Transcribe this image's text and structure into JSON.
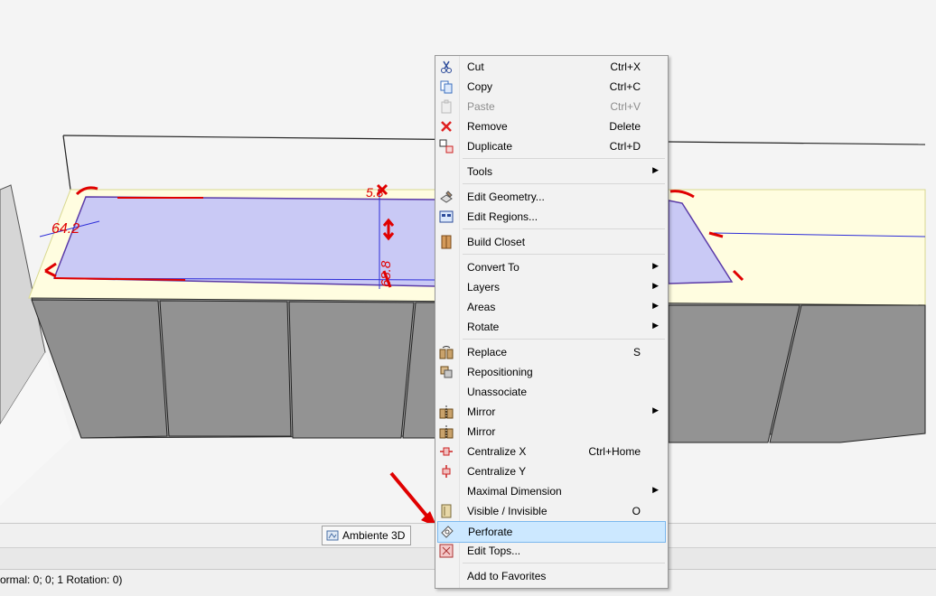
{
  "viewport": {
    "dimension_labels": [
      "64.2",
      "5.8",
      "68.8"
    ]
  },
  "tab": {
    "label": "Ambiente 3D"
  },
  "status": {
    "text": "ormal: 0; 0; 1 Rotation: 0)"
  },
  "menu": {
    "items": [
      {
        "label": "Cut",
        "shortcut": "Ctrl+X",
        "icon": "scissors-icon"
      },
      {
        "label": "Copy",
        "shortcut": "Ctrl+C",
        "icon": "copy-icon"
      },
      {
        "label": "Paste",
        "shortcut": "Ctrl+V",
        "icon": "paste-icon",
        "disabled": true
      },
      {
        "label": "Remove",
        "shortcut": "Delete",
        "icon": "remove-x-icon"
      },
      {
        "label": "Duplicate",
        "shortcut": "Ctrl+D",
        "icon": "duplicate-icon"
      },
      {
        "label": "Tools",
        "submenu": true
      },
      {
        "label": "Edit Geometry...",
        "icon": "edit-geometry-icon"
      },
      {
        "label": "Edit Regions...",
        "icon": "edit-regions-icon"
      },
      {
        "label": "Build Closet",
        "icon": "build-closet-icon"
      },
      {
        "label": "Convert To",
        "submenu": true
      },
      {
        "label": "Layers",
        "submenu": true
      },
      {
        "label": "Areas",
        "submenu": true
      },
      {
        "label": "Rotate",
        "submenu": true
      },
      {
        "label": "Replace",
        "shortcut": "S",
        "icon": "replace-icon"
      },
      {
        "label": "Repositioning",
        "icon": "repositioning-icon"
      },
      {
        "label": "Unassociate"
      },
      {
        "label": "Mirror",
        "submenu": true,
        "icon": "mirror-icon"
      },
      {
        "label": "Mirror",
        "icon": "mirror-icon"
      },
      {
        "label": "Centralize X",
        "shortcut": "Ctrl+Home",
        "icon": "centralize-x-icon"
      },
      {
        "label": "Centralize Y",
        "icon": "centralize-y-icon"
      },
      {
        "label": "Maximal Dimension",
        "submenu": true
      },
      {
        "label": "Visible / Invisible",
        "shortcut": "O",
        "icon": "visibility-icon"
      },
      {
        "label": "Perforate",
        "icon": "perforate-icon",
        "highlighted": true
      },
      {
        "label": "Edit Tops...",
        "icon": "edit-tops-icon"
      },
      {
        "label": "Add to Favorites"
      }
    ]
  },
  "colors": {
    "highlight": "#cce8ff",
    "highlight_border": "#7bb8ee",
    "countertop_fill": "#c9c9f5",
    "arrow_red": "#e00000"
  }
}
